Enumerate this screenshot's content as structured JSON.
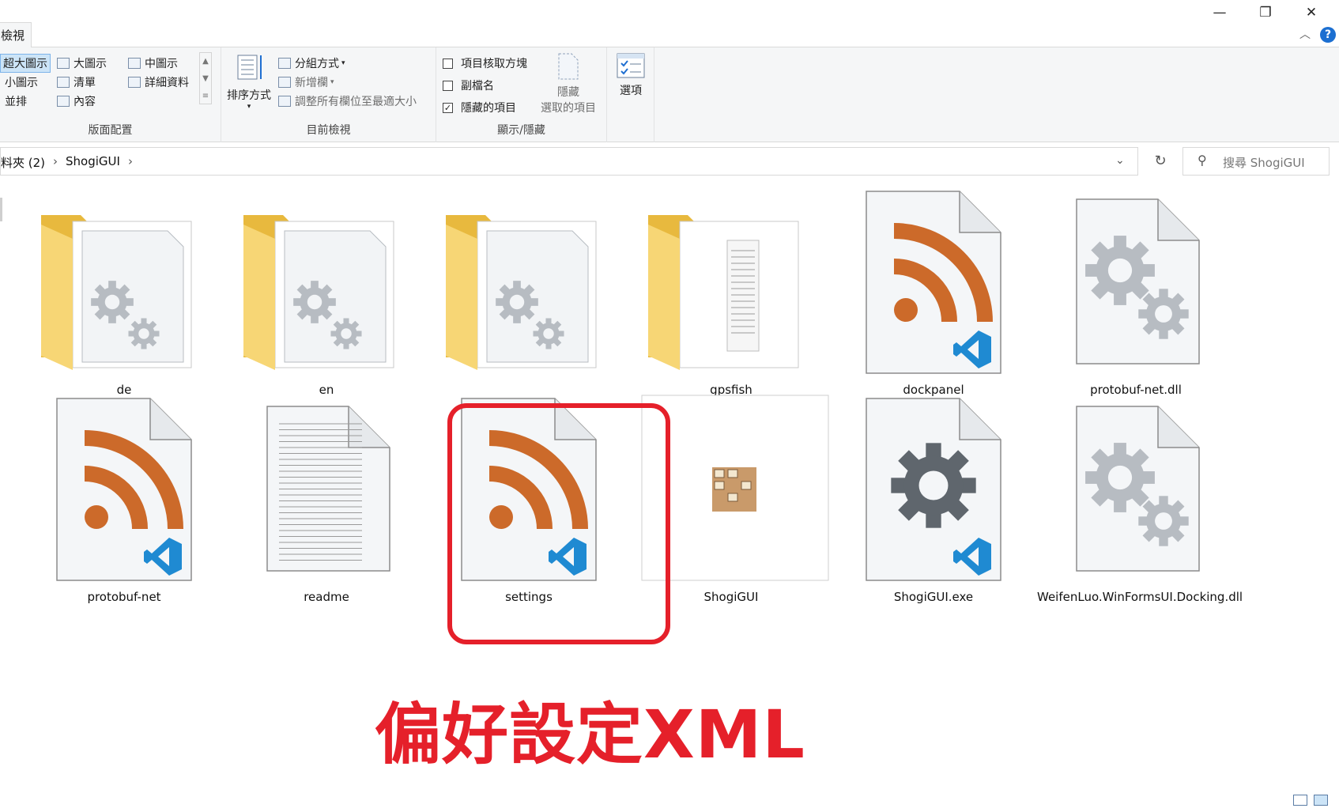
{
  "window": {
    "minimize": "—",
    "restore": "❐",
    "close": "✕"
  },
  "tabs": {
    "view": "檢視"
  },
  "ribbon": {
    "layout": {
      "label": "版面配置",
      "items": [
        "超大圖示",
        "大圖示",
        "中圖示",
        "小圖示",
        "清單",
        "詳細資料",
        "並排",
        "內容"
      ]
    },
    "current_view": {
      "label": "目前檢視",
      "sort": "排序方式",
      "group_by": "分組方式",
      "add_column": "新增欄",
      "fit_columns": "調整所有欄位至最適大小"
    },
    "show_hide": {
      "label": "顯示/隱藏",
      "item_checkboxes": "項目核取方塊",
      "file_extensions": "副檔名",
      "hidden_items": "隱藏的項目",
      "hide_selected_line1": "隱藏",
      "hide_selected_line2": "選取的項目"
    },
    "options": "選項"
  },
  "address": {
    "breadcrumb": [
      "料夾 (2)",
      "ShogiGUI"
    ],
    "search_placeholder": "搜尋 ShogiGUI"
  },
  "files": [
    {
      "name": "de",
      "type": "folder-gears"
    },
    {
      "name": "en",
      "type": "folder-gears"
    },
    {
      "name": "",
      "type": "folder-gears"
    },
    {
      "name": "gpsfish",
      "type": "folder-docs"
    },
    {
      "name": "dockpanel",
      "type": "xml-vscode"
    },
    {
      "name": "protobuf-net.dll",
      "type": "dll"
    },
    {
      "name": "protobuf-net",
      "type": "xml-vscode"
    },
    {
      "name": "readme",
      "type": "text"
    },
    {
      "name": "settings",
      "type": "xml-vscode"
    },
    {
      "name": "ShogiGUI",
      "type": "image"
    },
    {
      "name": "ShogiGUI.exe",
      "type": "exe-vscode"
    },
    {
      "name": "WeifenLuo.WinFormsUI.Docking.dll",
      "type": "dll"
    }
  ],
  "annotation": "偏好設定XML",
  "colors": {
    "accent_red": "#e5202a",
    "rss_orange": "#cc6a2a",
    "vscode_blue": "#1f8ad2",
    "folder_yellow": "#f7d675"
  }
}
